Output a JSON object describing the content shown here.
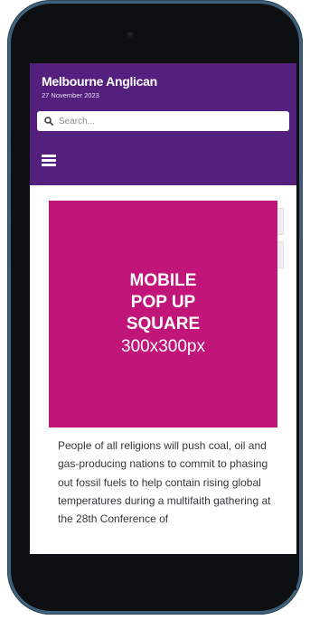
{
  "header": {
    "site_title": "Melbourne Anglican",
    "date": "27 November 2023",
    "search_placeholder": "Search..."
  },
  "ad": {
    "line1": "MOBILE",
    "line2": "POP UP",
    "line3": "SQUARE",
    "size": "300x300px"
  },
  "article": {
    "text": "People of all religions will push coal, oil and gas-producing nations to commit to phasing out fossil fuels to help contain rising global temperatures during a multifaith gathering at the 28th Conference of"
  },
  "colors": {
    "header_bg": "#53207e",
    "ad_bg": "#c1157a",
    "phone_frame": "#3f627c"
  },
  "icons": {
    "search": "search-icon",
    "menu": "hamburger-menu-icon"
  }
}
